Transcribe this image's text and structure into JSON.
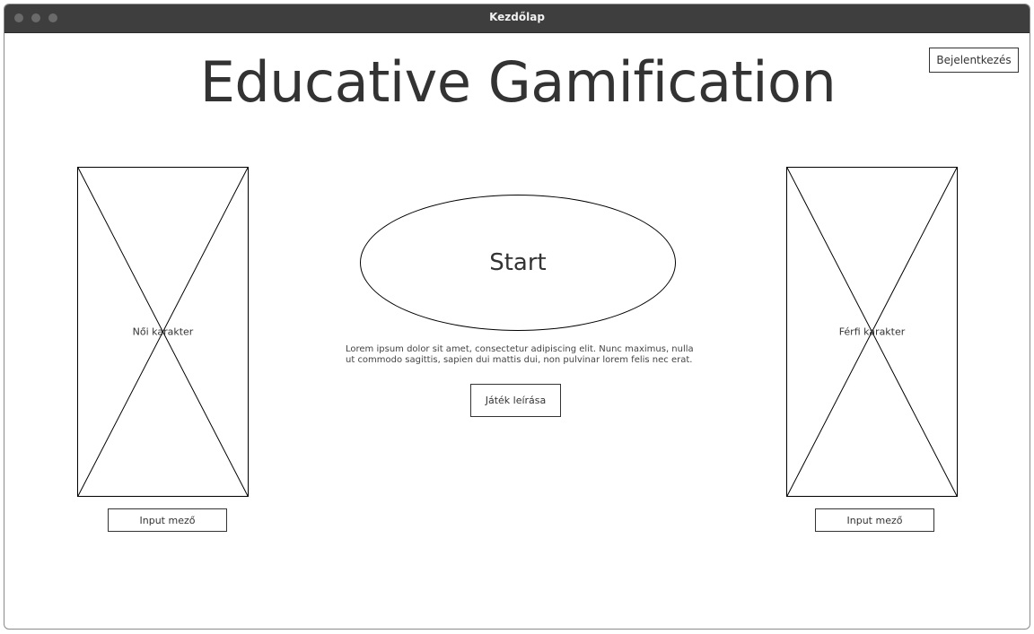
{
  "window": {
    "title": "Kezdőlap"
  },
  "header": {
    "title": "Educative Gamification",
    "login_label": "Bejelentkezés"
  },
  "characters": {
    "female": {
      "label": "Női karakter",
      "input_placeholder": "Input mező"
    },
    "male": {
      "label": "Férfi karakter",
      "input_placeholder": "Input mező"
    }
  },
  "main": {
    "start_label": "Start",
    "description": "Lorem ipsum dolor sit amet, consectetur adipiscing elit. Nunc maximus, nulla ut commodo sagittis, sapien dui mattis dui, non pulvinar lorem felis nec erat.",
    "description_button_label": "Játék leírása"
  },
  "colors": {
    "titlebar": "#3e3e3e",
    "text": "#333333",
    "border": "#000000"
  }
}
